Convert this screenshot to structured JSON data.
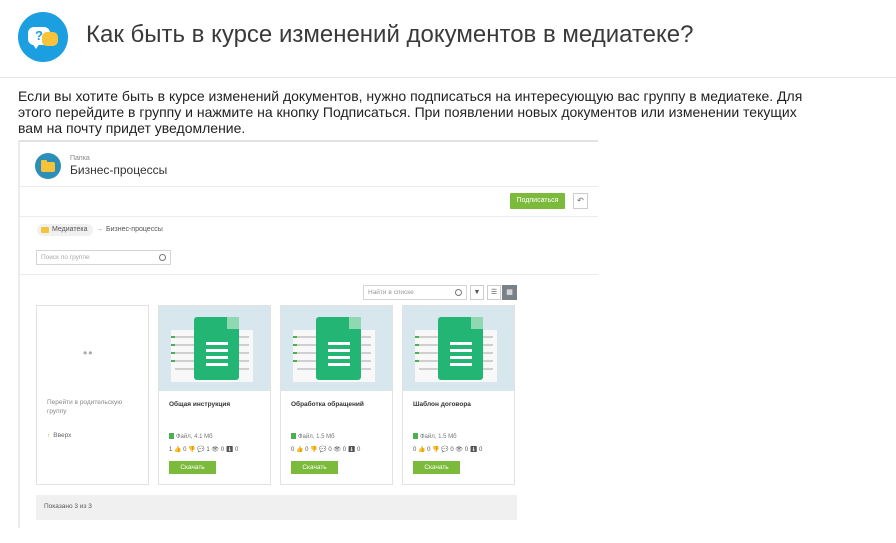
{
  "header": {
    "title": "Как быть в курсе изменений документов в медиатеке?",
    "icon": "faq-chat-icon",
    "icon_glyph": "?"
  },
  "intro_text": "Если вы хотите быть в курсе изменений документов, нужно подписаться на интересующую вас группу в медиатеке. Для этого перейдите в группу и нажмите на кнопку Подписаться. При появлении новых документов или изменении текущих вам на почту придет уведомление.",
  "screenshot": {
    "folder_kind": "Папка",
    "folder_name": "Бизнес-процессы",
    "subscribe_label": "Подписаться",
    "back_glyph": "↶",
    "breadcrumb": {
      "home": "Медиатека",
      "separator": "→",
      "current": "Бизнес-процессы"
    },
    "group_search_placeholder": "Поиск по группе",
    "list_search_placeholder": "Найти в списке",
    "filter_glyph": "▼",
    "list_view_glyph": "☰",
    "grid_view_glyph": "▦",
    "parent_card": {
      "dots": "••",
      "text": "Перейти в родительскую группу",
      "up_label": "Вверх",
      "up_glyph": "↑"
    },
    "files": [
      {
        "name": "Общая инструкция",
        "meta": "Файл, 4.1 Мб",
        "stats": "1 👍 0 👎  💬 1  👁 0  ⬇ 0",
        "download": "Скачать"
      },
      {
        "name": "Обработка обращений",
        "meta": "Файл, 1.5 Мб",
        "stats": "0 👍 0 👎  💬 0  👁 0  ⬇ 0",
        "download": "Скачать"
      },
      {
        "name": "Шаблон договора",
        "meta": "Файл, 1.5 Мб",
        "stats": "0 👍 0 👎  💬 0  👁 0  ⬇ 0",
        "download": "Скачать"
      }
    ],
    "footer": "Показано 3 из 3"
  },
  "colors": {
    "accent_green": "#7cba3c",
    "icon_blue": "#1b9fe0",
    "doc_green": "#22b573"
  }
}
